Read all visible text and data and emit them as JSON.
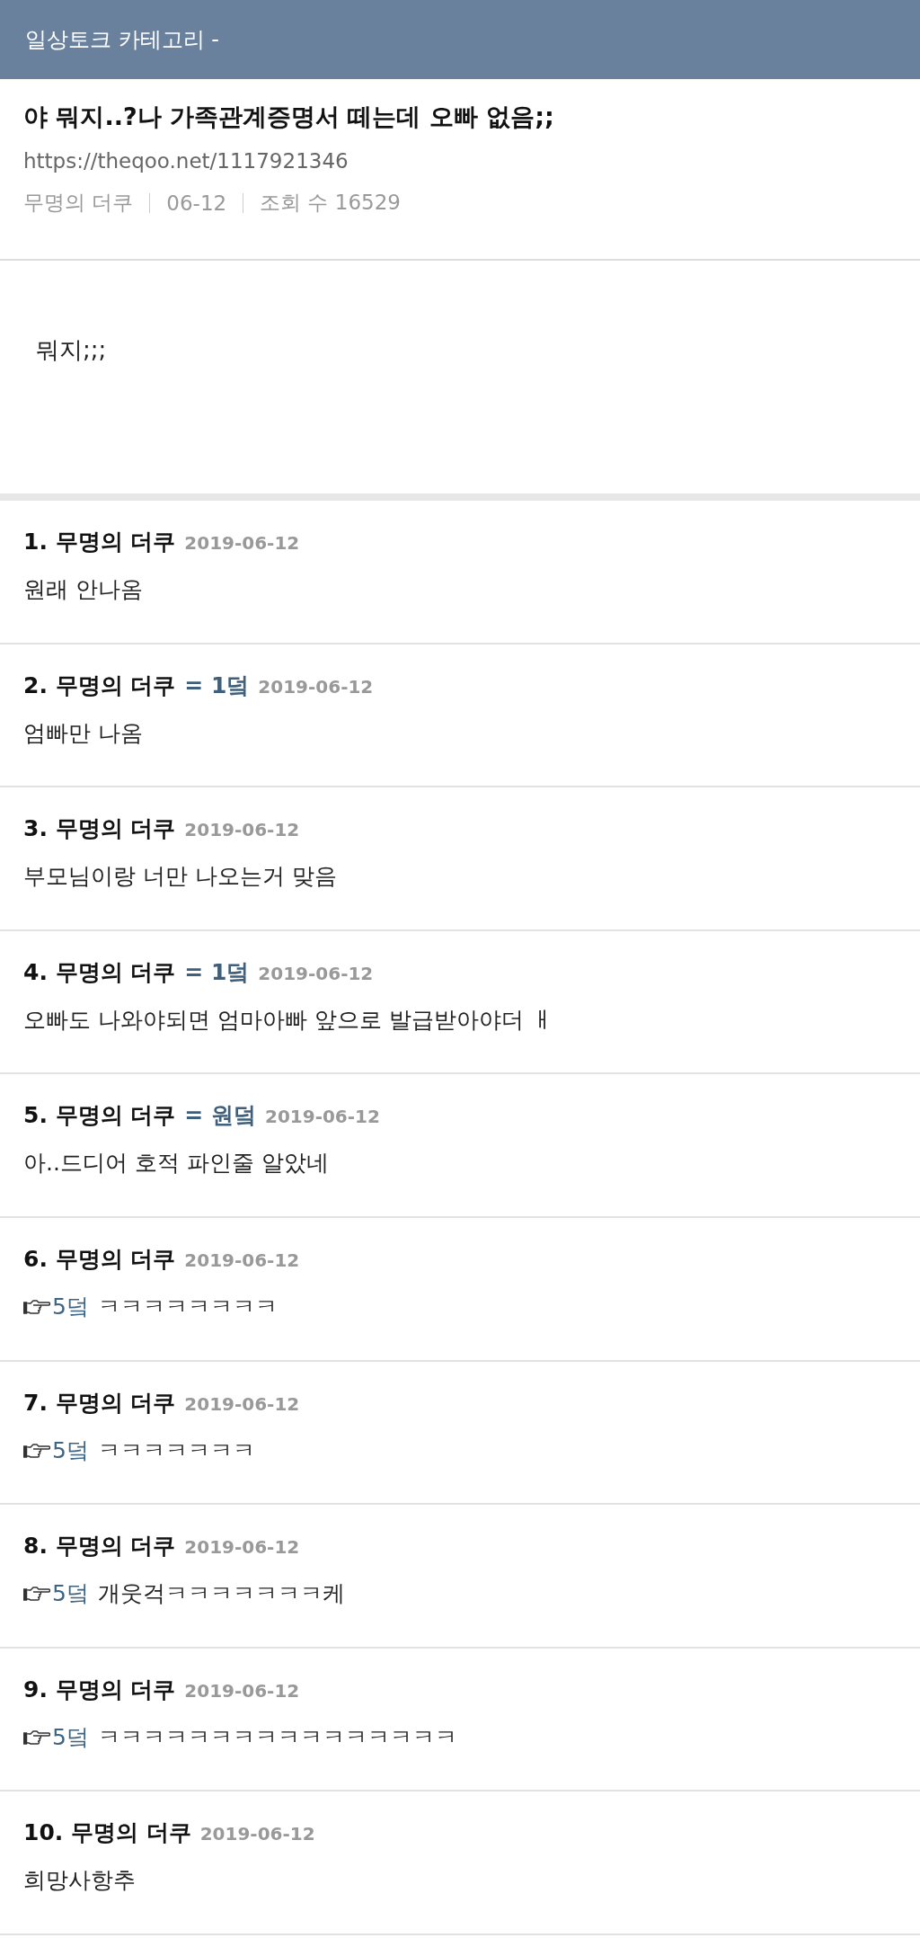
{
  "category_bar": {
    "title": "일상토크 카테고리 -"
  },
  "post": {
    "title": "야 뭐지..?나 가족관계증명서 떼는데 오빠 없음;;",
    "url": "https://theqoo.net/1117921346",
    "author": "무명의 더쿠",
    "date": "06-12",
    "views": "조회 수 16529",
    "body": "뭐지;;;"
  },
  "comments": [
    {
      "number": "1.",
      "author": "무명의 더쿠",
      "date": "2019-06-12",
      "text": "원래 안나옴"
    },
    {
      "number": "2.",
      "author": "무명의 더쿠",
      "tag": "= 1덬",
      "date": "2019-06-12",
      "text": "엄빠만 나옴"
    },
    {
      "number": "3.",
      "author": "무명의 더쿠",
      "date": "2019-06-12",
      "text": "부모님이랑 너만 나오는거 맞음"
    },
    {
      "number": "4.",
      "author": "무명의 더쿠",
      "tag": "= 1덬",
      "date": "2019-06-12",
      "text": "오빠도 나와야되면 엄마아빠 앞으로 발급받아야더 ㅐ"
    },
    {
      "number": "5.",
      "author": "무명의 더쿠",
      "tag": "= 원덬",
      "date": "2019-06-12",
      "text": "아..드디어 호적 파인줄 알았네"
    },
    {
      "number": "6.",
      "author": "무명의 더쿠",
      "date": "2019-06-12",
      "reply_to": "5덬",
      "text": "ㅋㅋㅋㅋㅋㅋㅋㅋ"
    },
    {
      "number": "7.",
      "author": "무명의 더쿠",
      "date": "2019-06-12",
      "reply_to": "5덬",
      "text": "ㅋㅋㅋㅋㅋㅋㅋ"
    },
    {
      "number": "8.",
      "author": "무명의 더쿠",
      "date": "2019-06-12",
      "reply_to": "5덬",
      "text": "개웃걱ㅋㅋㅋㅋㅋㅋㅋ케"
    },
    {
      "number": "9.",
      "author": "무명의 더쿠",
      "date": "2019-06-12",
      "reply_to": "5덬",
      "text": "ㅋㅋㅋㅋㅋㅋㅋㅋㅋㅋㅋㅋㅋㅋㅋㅋ"
    },
    {
      "number": "10.",
      "author": "무명의 더쿠",
      "date": "2019-06-12",
      "text": "희망사항추"
    }
  ]
}
